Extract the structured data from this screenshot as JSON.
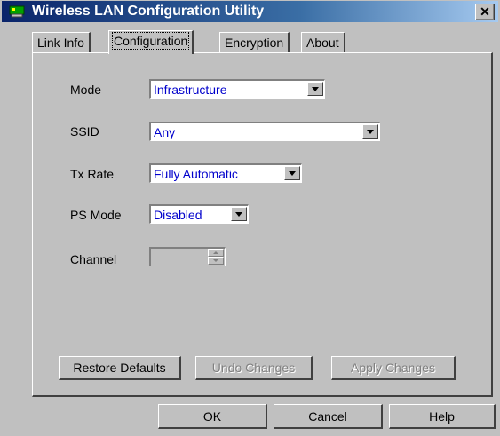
{
  "window": {
    "title": "Wireless LAN Configuration Utility",
    "close_glyph": "✕",
    "app_icon": "network-card-icon"
  },
  "tabs": [
    {
      "label": "Link Info",
      "active": false
    },
    {
      "label": "Configuration",
      "active": true
    },
    {
      "label": "Encryption",
      "active": false
    },
    {
      "label": "About",
      "active": false
    }
  ],
  "config": {
    "mode_label": "Mode",
    "mode_value": "Infrastructure",
    "ssid_label": "SSID",
    "ssid_value": "Any",
    "txrate_label": "Tx Rate",
    "txrate_value": "Fully Automatic",
    "psmode_label": "PS Mode",
    "psmode_value": "Disabled",
    "channel_label": "Channel",
    "channel_value": ""
  },
  "actions": {
    "restore_label": "Restore Defaults",
    "undo_label": "Undo Changes",
    "apply_label": "Apply Changes"
  },
  "dialog": {
    "ok_label": "OK",
    "cancel_label": "Cancel",
    "help_label": "Help"
  },
  "colors": {
    "value_text": "#0000cc",
    "face": "#c0c0c0",
    "title_start": "#0a246a",
    "title_end": "#a6caf0"
  }
}
